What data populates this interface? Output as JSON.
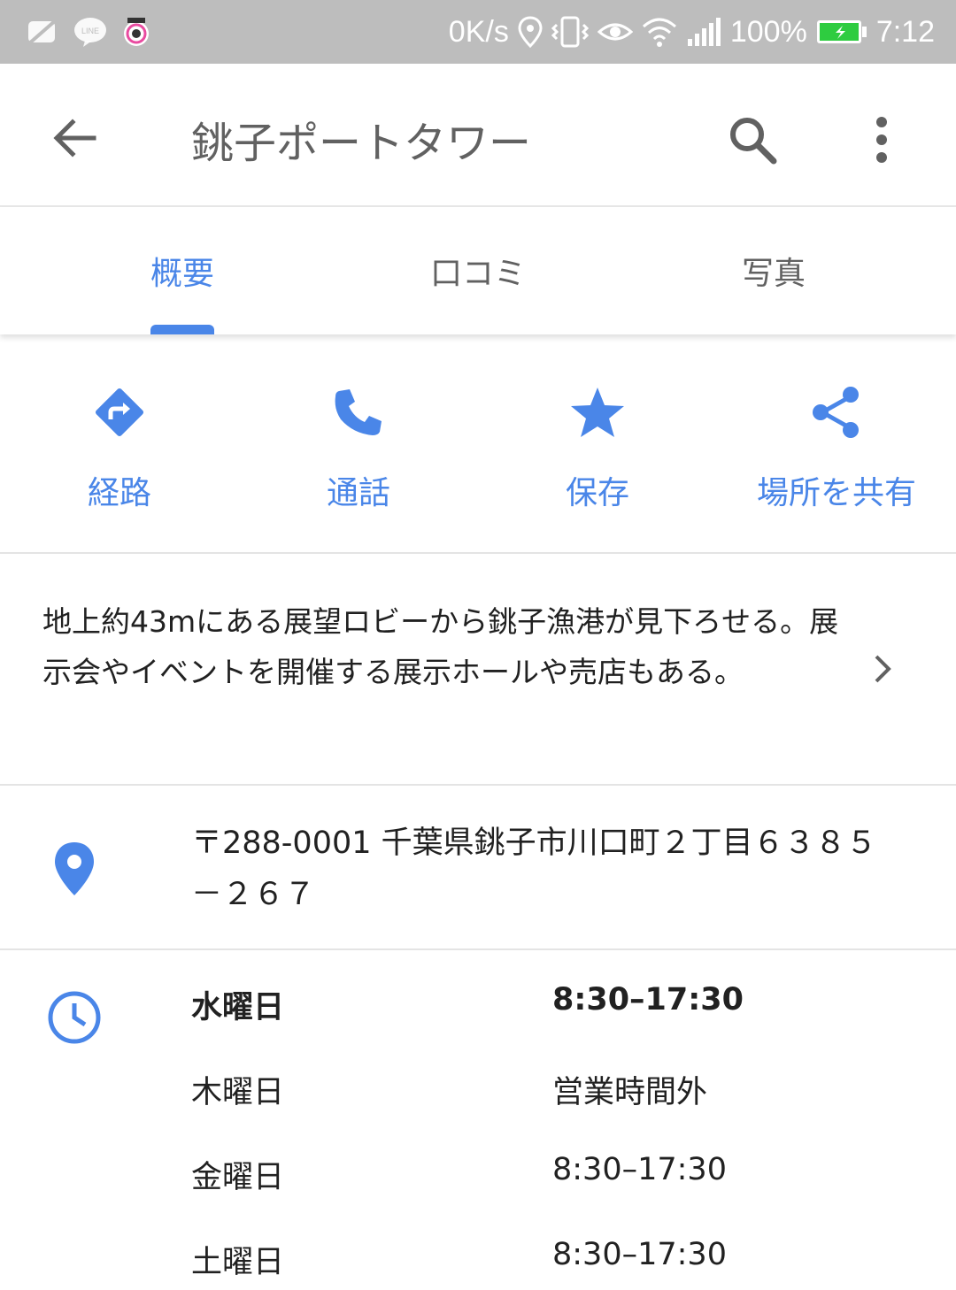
{
  "status_bar": {
    "net_speed": "0K/s",
    "battery": "100%",
    "time": "7:12",
    "icons": [
      "notification-off-icon",
      "line-app-icon",
      "app-icon",
      "location-icon",
      "vibrate-icon",
      "eye-icon",
      "wifi-icon",
      "signal-icon",
      "battery-icon"
    ]
  },
  "app_bar": {
    "title": "銚子ポートタワー",
    "icons": [
      "back-arrow-icon",
      "search-icon",
      "more-vert-icon"
    ]
  },
  "tabs": [
    {
      "label": "概要",
      "active": true
    },
    {
      "label": "口コミ",
      "active": false
    },
    {
      "label": "写真",
      "active": false
    }
  ],
  "actions": [
    {
      "label": "経路",
      "icon": "directions-icon"
    },
    {
      "label": "通話",
      "icon": "phone-icon"
    },
    {
      "label": "保存",
      "icon": "star-icon"
    },
    {
      "label": "場所を共有",
      "icon": "share-icon"
    }
  ],
  "description": "地上約43mにある展望ロビーから銚子漁港が見下ろせる。展示会やイベントを開催する展示ホールや売店もある。",
  "address": "〒288-0001 千葉県銚子市川口町２丁目６３８５－２６７",
  "hours": [
    {
      "day": "水曜日",
      "time": "8:30–17:30",
      "today": true
    },
    {
      "day": "木曜日",
      "time": "営業時間外",
      "today": false
    },
    {
      "day": "金曜日",
      "time": "8:30–17:30",
      "today": false
    },
    {
      "day": "土曜日",
      "time": "8:30–17:30",
      "today": false
    }
  ],
  "colors": {
    "accent": "#4a86e8",
    "status_bar": "#bdbdbd",
    "battery": "#2ecc40"
  }
}
